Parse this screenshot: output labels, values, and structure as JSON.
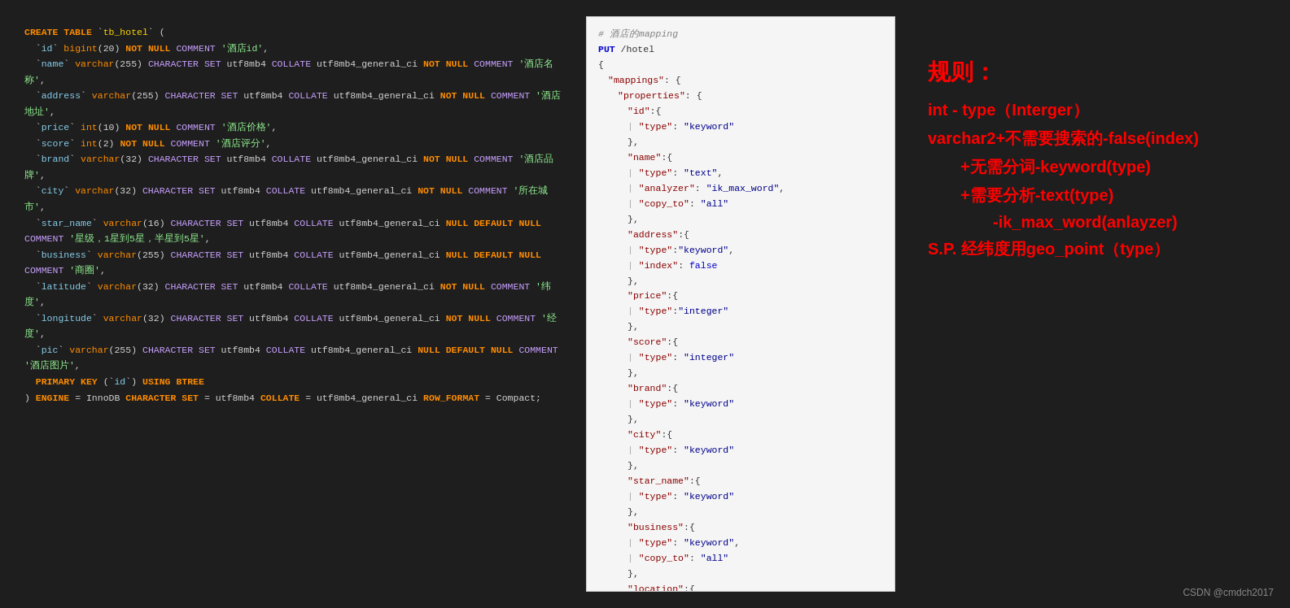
{
  "sql": {
    "lines": [
      {
        "type": "create",
        "content": "CREATE TABLE `tb_hotel`  ("
      },
      {
        "type": "field",
        "content": "  `id` bigint(20) NOT NULL COMMENT '酒店id',"
      },
      {
        "type": "field",
        "content": "  `name` varchar(255) CHARACTER SET utf8mb4 COLLATE utf8mb4_general_ci NOT NULL COMMENT '酒店名称',"
      },
      {
        "type": "field",
        "content": "  `address` varchar(255) CHARACTER SET utf8mb4 COLLATE utf8mb4_general_ci NOT NULL COMMENT '酒店地址',"
      },
      {
        "type": "field",
        "content": "  `price` int(10) NOT NULL COMMENT '酒店价格',"
      },
      {
        "type": "field",
        "content": "  `score` int(2) NOT NULL COMMENT '酒店评分',"
      },
      {
        "type": "field",
        "content": "  `brand` varchar(32) CHARACTER SET utf8mb4 COLLATE utf8mb4_general_ci NOT NULL COMMENT '酒店品牌',"
      },
      {
        "type": "field",
        "content": "  `city` varchar(32) CHARACTER SET utf8mb4 COLLATE utf8mb4_general_ci NOT NULL COMMENT '所在城市',"
      },
      {
        "type": "field",
        "content": "  `star_name` varchar(16) CHARACTER SET utf8mb4 COLLATE utf8mb4_general_ci NULL DEFAULT NULL COMMENT '星级，1星到5星，半星到5星',"
      },
      {
        "type": "field",
        "content": "  `business` varchar(255) CHARACTER SET utf8mb4 COLLATE utf8mb4_general_ci NULL DEFAULT NULL COMMENT '商圈',"
      },
      {
        "type": "field",
        "content": "  `latitude` varchar(32) CHARACTER SET utf8mb4 COLLATE utf8mb4_general_ci NOT NULL COMMENT '纬度',"
      },
      {
        "type": "field",
        "content": "  `longitude` varchar(32) CHARACTER SET utf8mb4 COLLATE utf8mb4_general_ci NOT NULL COMMENT '经度',"
      },
      {
        "type": "field",
        "content": "  `pic` varchar(255) CHARACTER SET utf8mb4 COLLATE utf8mb4_general_ci NULL DEFAULT NULL COMMENT '酒店图片',"
      },
      {
        "type": "pk",
        "content": "  PRIMARY KEY (`id`) USING BTREE"
      },
      {
        "type": "engine",
        "content": ") ENGINE = InnoDB CHARACTER SET = utf8mb4 COLLATE = utf8mb4_general_ci ROW_FORMAT = Compact;"
      }
    ]
  },
  "json_panel": {
    "title_comment": "# 酒店的mapping",
    "title_put": "PUT /hotel",
    "content": "..."
  },
  "rules": {
    "title": "规则：",
    "lines": [
      "int - type（Interger）",
      "varchar2+不需要搜索的-false(index)",
      "+无需分词-keyword(type)",
      "+需要分析-text(type)",
      "-ik_max_word(anlayzer)",
      "S.P. 经纬度用geo_point（type）"
    ]
  },
  "watermark": "CSDN @cmdch2017"
}
